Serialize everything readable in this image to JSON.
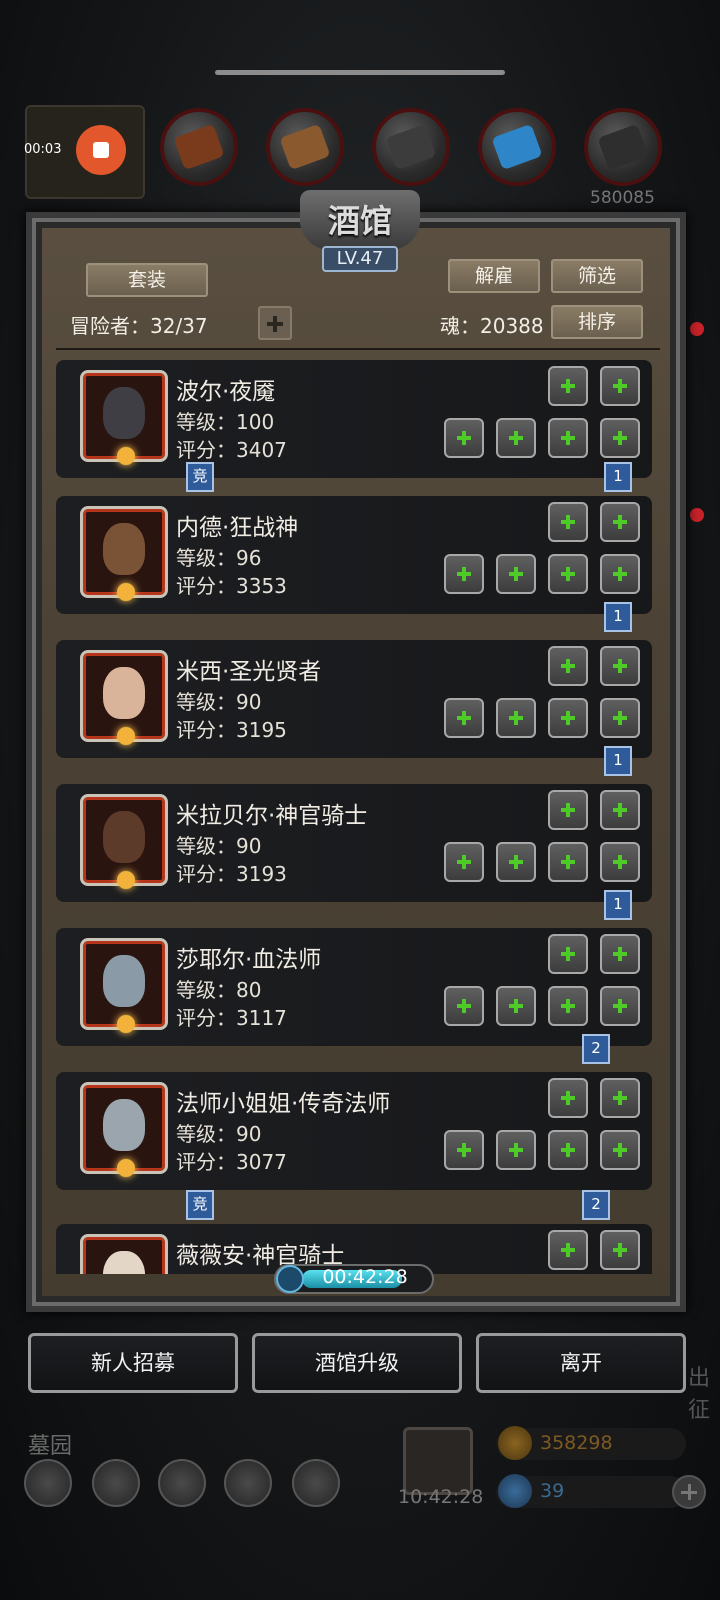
{
  "status": {
    "record_time": "00:03"
  },
  "top_bar": {
    "right_number": "580085"
  },
  "tavern": {
    "title": "酒馆",
    "level": "LV.47",
    "suit_button": "套装",
    "dismiss_button": "解雇",
    "filter_button": "筛选",
    "sort_button": "排序",
    "adventurer_label": "冒险者：32/37",
    "soul_label": "魂：20388"
  },
  "heroes": [
    {
      "name": "波尔·夜魇",
      "level": "等级：100",
      "score": "评分：3407",
      "left_tag": "竞",
      "right_tag": "1",
      "face_color": "#3e3e44"
    },
    {
      "name": "内德·狂战神",
      "level": "等级：96",
      "score": "评分：3353",
      "left_tag": "",
      "right_tag": "1",
      "face_color": "#7a5236"
    },
    {
      "name": "米西·圣光贤者",
      "level": "等级：90",
      "score": "评分：3195",
      "left_tag": "",
      "right_tag": "1",
      "face_color": "#d9b49a"
    },
    {
      "name": "米拉贝尔·神官骑士",
      "level": "等级：90",
      "score": "评分：3193",
      "left_tag": "",
      "right_tag": "1",
      "face_color": "#5c3b2a"
    },
    {
      "name": "莎耶尔·血法师",
      "level": "等级：80",
      "score": "评分：3117",
      "left_tag": "",
      "right_tag": "2",
      "face_color": "#8a9aa6"
    },
    {
      "name": "法师小姐姐·传奇法师",
      "level": "等级：90",
      "score": "评分：3077",
      "left_tag": "竞",
      "right_tag": "2",
      "face_color": "#9aa5ae"
    },
    {
      "name": "薇薇安·神官骑士",
      "level": "",
      "score": "",
      "left_tag": "",
      "right_tag": "",
      "face_color": "#e4d6c6"
    }
  ],
  "timer": {
    "value": "00:42:28"
  },
  "bottom_buttons": {
    "recruit": "新人招募",
    "upgrade": "酒馆升级",
    "leave": "离开"
  },
  "underlay": {
    "graveyard": "墓园",
    "gift_timer": "10:42:28",
    "gold": "358298",
    "gems": "39",
    "right_edge_text": "出征"
  },
  "colors": {
    "accent_green": "#4ecb29",
    "tag_blue": "#2f5b9a",
    "panel_brown": "#4b4235",
    "timer_cyan": "#59e2ef"
  }
}
